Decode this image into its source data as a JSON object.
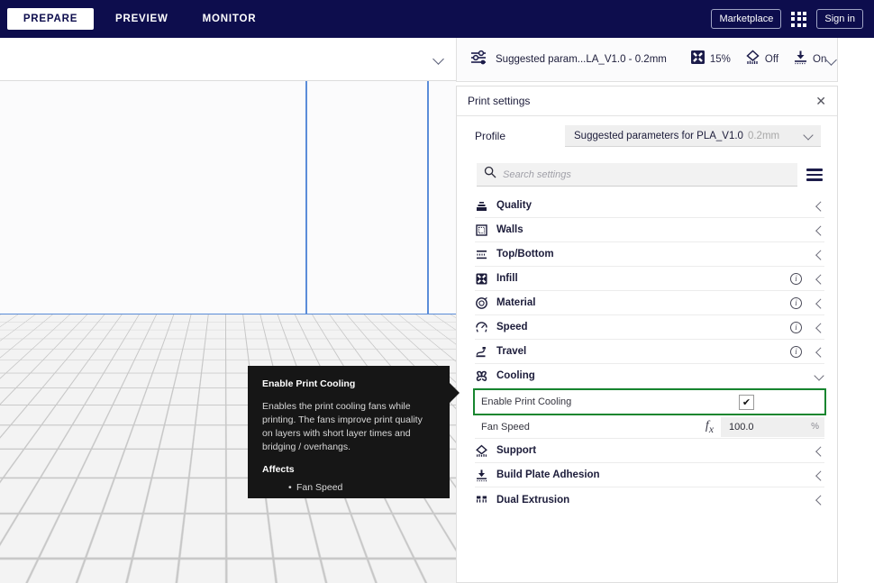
{
  "topbar": {
    "stages": [
      {
        "label": "PREPARE",
        "active": true
      },
      {
        "label": "PREVIEW",
        "active": false
      },
      {
        "label": "MONITOR",
        "active": false
      }
    ],
    "marketplace_label": "Marketplace",
    "signin_label": "Sign in",
    "apps_icon": "apps-grid-icon"
  },
  "viewport": {
    "collapse_icon": "chevron-down-icon"
  },
  "tooltip": {
    "title": "Enable Print Cooling",
    "body": "Enables the print cooling fans while printing. The fans improve print quality on layers with short layer times and bridging / overhangs.",
    "affects_label": "Affects",
    "affects": [
      "Fan Speed"
    ]
  },
  "summary_bar": {
    "settings_icon": "sliders-icon",
    "profile_text": "Suggested param...LA_V1.0 - 0.2mm",
    "infill_icon": "infill-icon",
    "infill_value": "15%",
    "support_icon": "support-icon",
    "support_value": "Off",
    "adhesion_icon": "build-plate-adhesion-icon",
    "adhesion_value": "On",
    "expand_icon": "chevron-down-icon"
  },
  "panel": {
    "title": "Print settings",
    "close_icon": "close-icon",
    "profile_label": "Profile",
    "profile_value": "Suggested parameters for PLA_V1.0",
    "profile_variant": "0.2mm",
    "profile_chevron": "chevron-down-icon",
    "search_icon": "search-icon",
    "search_placeholder": "Search settings",
    "visibility_icon": "settings-visibility-icon",
    "categories": [
      {
        "label": "Quality",
        "icon": "quality-icon",
        "info": false,
        "expanded": false
      },
      {
        "label": "Walls",
        "icon": "walls-icon",
        "info": false,
        "expanded": false
      },
      {
        "label": "Top/Bottom",
        "icon": "top-bottom-icon",
        "info": false,
        "expanded": false
      },
      {
        "label": "Infill",
        "icon": "infill-icon",
        "info": true,
        "expanded": false
      },
      {
        "label": "Material",
        "icon": "material-icon",
        "info": true,
        "expanded": false
      },
      {
        "label": "Speed",
        "icon": "speed-icon",
        "info": true,
        "expanded": false
      },
      {
        "label": "Travel",
        "icon": "travel-icon",
        "info": true,
        "expanded": false
      },
      {
        "label": "Cooling",
        "icon": "cooling-fan-icon",
        "info": false,
        "expanded": true
      },
      {
        "label": "Support",
        "icon": "support-icon",
        "info": false,
        "expanded": false
      },
      {
        "label": "Build Plate Adhesion",
        "icon": "build-plate-adhesion-icon",
        "info": false,
        "expanded": false
      },
      {
        "label": "Dual Extrusion",
        "icon": "dual-extrusion-icon",
        "info": false,
        "expanded": false
      }
    ],
    "cooling_settings": [
      {
        "label": "Enable Print Cooling",
        "type": "checkbox",
        "checked": true,
        "check_glyph": "✔",
        "highlighted": true
      },
      {
        "label": "Fan Speed",
        "type": "number",
        "formula_icon": "fx",
        "value": "100.0",
        "unit": "%",
        "highlighted": false
      }
    ]
  },
  "colors": {
    "brand_navy": "#0d0d4d",
    "highlight_green": "#17862f",
    "build_plate_outline": "#5b8dd9",
    "tooltip_bg": "#161616"
  }
}
